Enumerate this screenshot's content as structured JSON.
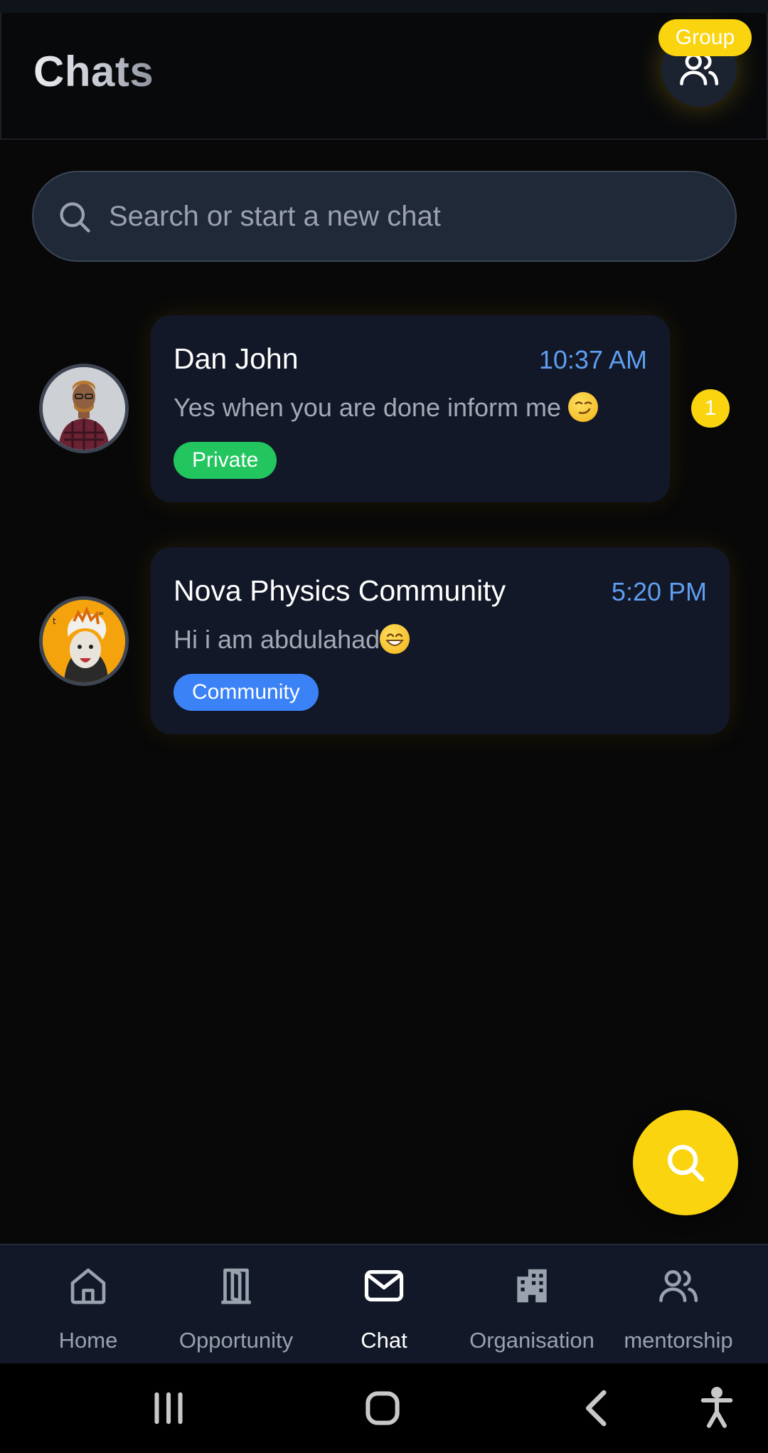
{
  "header": {
    "title": "Chats",
    "group_label": "Group"
  },
  "search": {
    "placeholder": "Search or start a new chat"
  },
  "chats": [
    {
      "name": "Dan John",
      "time": "10:37 AM",
      "message": "Yes when you are done inform me",
      "message_emoji": "smirking-face",
      "tag": "Private",
      "tag_color": "#22c55e",
      "unread_count": "1"
    },
    {
      "name": "Nova Physics Community",
      "time": "5:20 PM",
      "message": "Hi i am abdulahad",
      "message_emoji": "grinning-face",
      "tag": "Community",
      "tag_color": "#3b82f6"
    }
  ],
  "nav": {
    "items": [
      {
        "label": "Home",
        "icon": "home-icon",
        "active": false
      },
      {
        "label": "Opportunity",
        "icon": "door-icon",
        "active": false
      },
      {
        "label": "Chat",
        "icon": "mail-icon",
        "active": true
      },
      {
        "label": "Organisation",
        "icon": "building-icon",
        "active": false
      },
      {
        "label": "mentorship",
        "icon": "users-icon",
        "active": false
      }
    ]
  },
  "colors": {
    "accent": "#fad40f",
    "background": "#080809",
    "card": "#121827",
    "time_text": "#5f9ef0"
  }
}
